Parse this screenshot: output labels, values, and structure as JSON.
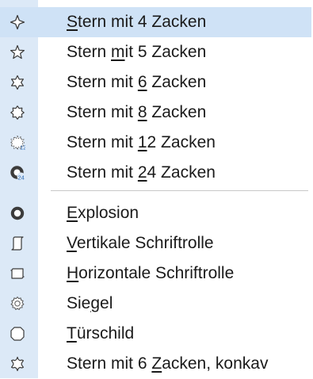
{
  "menu": {
    "group1": [
      {
        "pre": "",
        "key": "S",
        "post": "tern mit 4 Zacken",
        "icon": "star-4-icon",
        "selected": true
      },
      {
        "pre": "Stern ",
        "key": "m",
        "post": "it 5 Zacken",
        "icon": "star-5-icon",
        "selected": false
      },
      {
        "pre": "Stern mit ",
        "key": "6",
        "post": " Zacken",
        "icon": "star-6-icon",
        "selected": false
      },
      {
        "pre": "Stern mit ",
        "key": "8",
        "post": " Zacken",
        "icon": "star-8-icon",
        "selected": false
      },
      {
        "pre": "Stern mit ",
        "key": "1",
        "post": "2 Zacken",
        "icon": "star-12-icon",
        "selected": false
      },
      {
        "pre": "Stern mit ",
        "key": "2",
        "post": "4 Zacken",
        "icon": "star-24-icon",
        "selected": false
      }
    ],
    "group2": [
      {
        "pre": "",
        "key": "E",
        "post": "xplosion",
        "icon": "explosion-icon",
        "selected": false
      },
      {
        "pre": "",
        "key": "V",
        "post": "ertikale Schriftrolle",
        "icon": "vertical-scroll-icon",
        "selected": false
      },
      {
        "pre": "",
        "key": "H",
        "post": "orizontale Schriftrolle",
        "icon": "horizontal-scroll-icon",
        "selected": false
      },
      {
        "pre": "Sie",
        "key": "g",
        "post": "el",
        "icon": "seal-icon",
        "selected": false
      },
      {
        "pre": "",
        "key": "T",
        "post": "ürschild",
        "icon": "door-plate-icon",
        "selected": false
      },
      {
        "pre": "Stern mit 6 ",
        "key": "Z",
        "post": "acken, konkav",
        "icon": "concave-star-6-icon",
        "selected": false
      }
    ]
  },
  "badges": {
    "star12": "12",
    "star24": "24"
  },
  "colors": {
    "gutter": "#dce9f7",
    "selected": "#cfe2f6",
    "icon_stroke": "#3a3a3a"
  }
}
